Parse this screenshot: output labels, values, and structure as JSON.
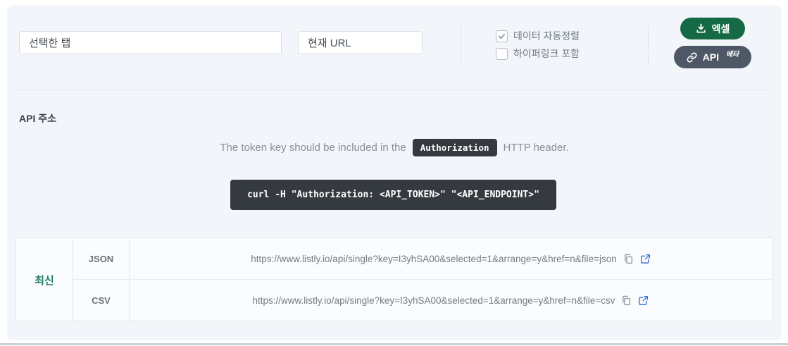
{
  "toolbar": {
    "selected_tab_input": {
      "value": "선택한 탭"
    },
    "current_url_input": {
      "value": "현재 URL"
    },
    "checkboxes": [
      {
        "label": "데이터 자동정렬",
        "checked": true
      },
      {
        "label": "하이퍼링크 포함",
        "checked": false
      }
    ],
    "excel_button": {
      "label": "엑셀",
      "icon": "download-icon",
      "color": "#156a45"
    },
    "api_button": {
      "label": "API",
      "badge": "베타",
      "icon": "link-icon",
      "color": "#4e5766"
    }
  },
  "api_section": {
    "heading": "API 주소",
    "token_note": {
      "before": "The token key should be included in the",
      "code": "Authorization",
      "after": "HTTP header."
    },
    "curl_command": "curl -H \"Authorization: <API_TOKEN>\" \"<API_ENDPOINT>\"",
    "table": {
      "group_label": "최신",
      "rows": [
        {
          "format": "JSON",
          "url": "https://www.listly.io/api/single?key=I3yhSA00&selected=1&arrange=y&href=n&file=json"
        },
        {
          "format": "CSV",
          "url": "https://www.listly.io/api/single?key=I3yhSA00&selected=1&arrange=y&href=n&file=csv"
        }
      ],
      "icons": [
        "copy-icon",
        "external-link-icon"
      ]
    }
  },
  "colors": {
    "card_bg": "#f2f5f9",
    "excel_green": "#156a45",
    "api_gray": "#4e5766",
    "code_dark": "#343a40",
    "group_teal": "#1e7e6b",
    "external_link_blue": "#3b6fd4"
  }
}
